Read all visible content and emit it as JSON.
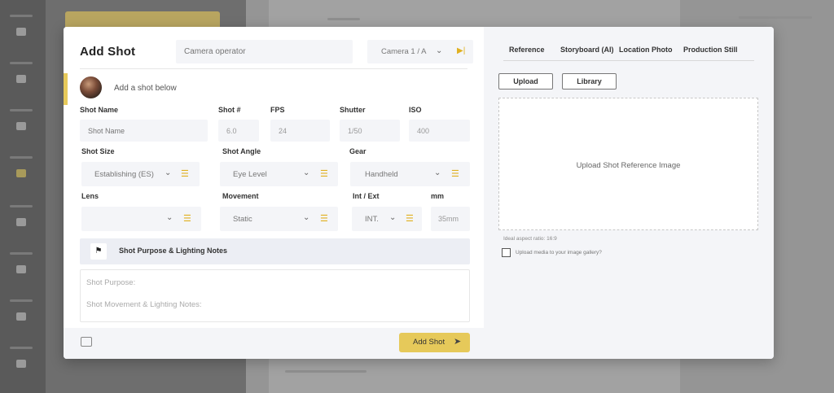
{
  "modal": {
    "title": "Add Shot",
    "camera_operator_placeholder": "Camera operator",
    "camera_select_value": "Camera 1 / A",
    "add_shot_prompt": "Add a shot below"
  },
  "fields": {
    "shot_name": {
      "label": "Shot Name",
      "placeholder": "Shot Name"
    },
    "shot_number": {
      "label": "Shot #",
      "value": "6.0"
    },
    "fps": {
      "label": "FPS",
      "value": "24"
    },
    "shutter": {
      "label": "Shutter",
      "value": "1/50"
    },
    "iso": {
      "label": "ISO",
      "value": "400"
    },
    "shot_size": {
      "label": "Shot Size",
      "value": "Establishing (ES)"
    },
    "shot_angle": {
      "label": "Shot Angle",
      "value": "Eye Level"
    },
    "gear": {
      "label": "Gear",
      "value": "Handheld"
    },
    "lens": {
      "label": "Lens",
      "value": ""
    },
    "movement": {
      "label": "Movement",
      "value": "Static"
    },
    "int_ext": {
      "label": "Int / Ext",
      "value": "INT."
    },
    "mm": {
      "label": "mm",
      "value": "35mm"
    }
  },
  "purpose": {
    "title": "Shot Purpose & Lighting Notes",
    "purpose_placeholder": "Shot Purpose:",
    "movement_placeholder": "Shot Movement & Lighting Notes:"
  },
  "footer": {
    "add_button": "Add Shot"
  },
  "right_panel": {
    "tabs": [
      "Reference",
      "Storyboard (AI)",
      "Location Photo",
      "Production Still"
    ],
    "upload_button": "Upload",
    "library_button": "Library",
    "dropzone_text": "Upload Shot Reference Image",
    "aspect_hint": "Ideal aspect ratio: 16:9",
    "gallery_checkbox_label": "Upload media to your image gallery?",
    "gallery_checked": false
  },
  "icons": {
    "close": "close-icon",
    "chevron": "chevron-down-icon",
    "next": "next-icon",
    "filter": "filter-icon",
    "flag": "flag-icon",
    "send": "send-icon",
    "media": "media-icon"
  },
  "colors": {
    "accent": "#e6c95a",
    "icon_accent": "#e0b020",
    "field_bg": "#f4f5f8"
  }
}
